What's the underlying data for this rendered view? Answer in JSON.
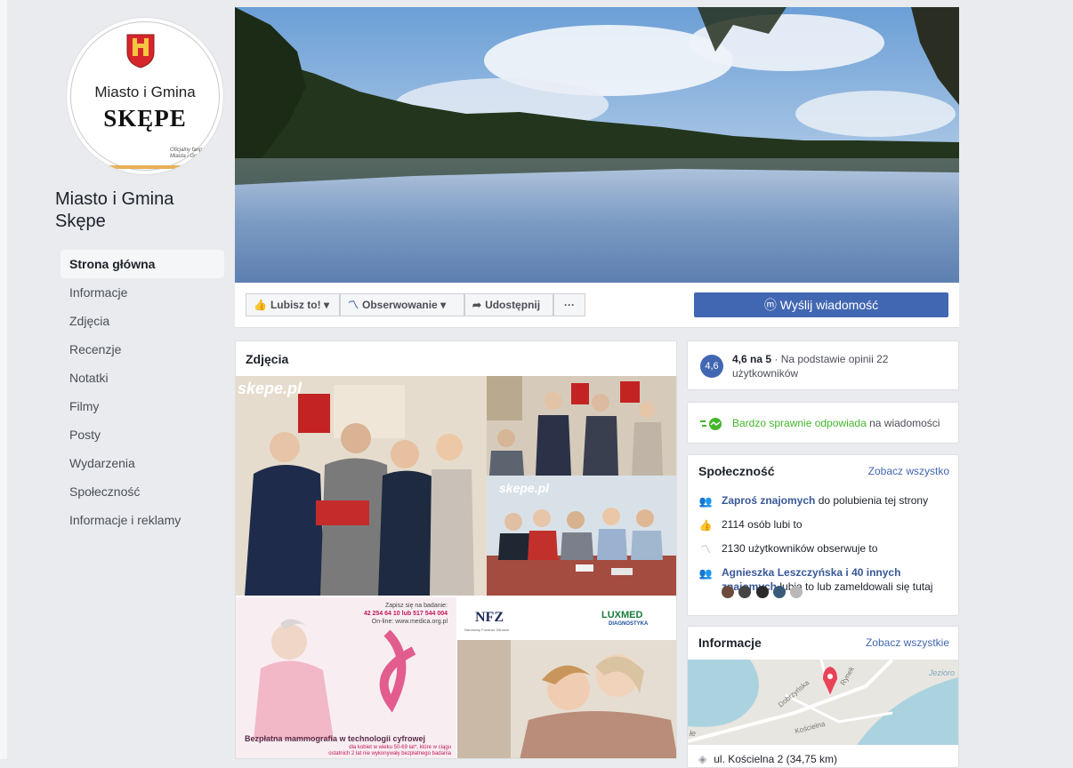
{
  "page": {
    "name": "Miasto i Gmina Skępe",
    "profile_line1": "Miasto i Gmina",
    "profile_line2": "SKĘPE",
    "profile_small": "Oficjalny fanpage Miasta i Gminy"
  },
  "nav": {
    "items": [
      {
        "label": "Strona główna",
        "active": true
      },
      {
        "label": "Informacje"
      },
      {
        "label": "Zdjęcia"
      },
      {
        "label": "Recenzje"
      },
      {
        "label": "Notatki"
      },
      {
        "label": "Filmy"
      },
      {
        "label": "Posty"
      },
      {
        "label": "Wydarzenia"
      },
      {
        "label": "Społeczność"
      },
      {
        "label": "Informacje i reklamy"
      }
    ]
  },
  "actions": {
    "like": "Lubisz to!",
    "follow": "Obserwowanie",
    "share": "Udostępnij",
    "more": "···",
    "send_message": "Wyślij wiadomość"
  },
  "photos": {
    "title": "Zdjęcia",
    "watermark1": "skepe.pl",
    "watermark2": "skepe.pl",
    "ad1": {
      "top1": "Zapisz się na badanie:",
      "top2": "42 254 64 10 lub 517 544 004",
      "top3": "On-line: www.medica.org.pl",
      "headline": "Bezpłatna mammografia w technologii cyfrowej",
      "sub1": "dla kobiet w wieku 50-69 lat*, które w ciągu",
      "sub2": "ostatnich 2 lat nie wykonywały bezpłatnego badania"
    },
    "ad2": {
      "logo_left": "NFZ",
      "logo_left_sub": "Narodowy Fundusz Zdrowia",
      "logo_right": "LUXMED",
      "logo_right_sub": "DIAGNOSTYKA"
    }
  },
  "rating": {
    "score": "4,6",
    "bold": "4,6 na 5",
    "text": " · Na podstawie opinii 22 użytkowników"
  },
  "response": {
    "highlight": "Bardzo sprawnie odpowiada",
    "rest": " na wiadomości"
  },
  "community": {
    "title": "Społeczność",
    "see_all": "Zobacz wszystko",
    "invite_link": "Zaproś znajomych",
    "invite_rest": " do polubienia tej strony",
    "likes": "2114 osób lubi to",
    "follows": "2130 użytkowników obserwuje to",
    "friends_link": "Agnieszka Leszczyńska i 40 innych znajomych",
    "friends_rest": " lubią to lub zameldowali się tutaj"
  },
  "info": {
    "title": "Informacje",
    "see_all": "Zobacz wszystkie",
    "map_label1": "Jezioro",
    "map_label2": "Dobrzyńska",
    "map_label3": "Kościelna",
    "map_label4": "Rynek",
    "map_label5": "łe",
    "address": "ul. Kościelna 2 (34,75 km)"
  },
  "colors": {
    "brand": "#4267b2",
    "link": "#385898",
    "green": "#42b72a"
  }
}
